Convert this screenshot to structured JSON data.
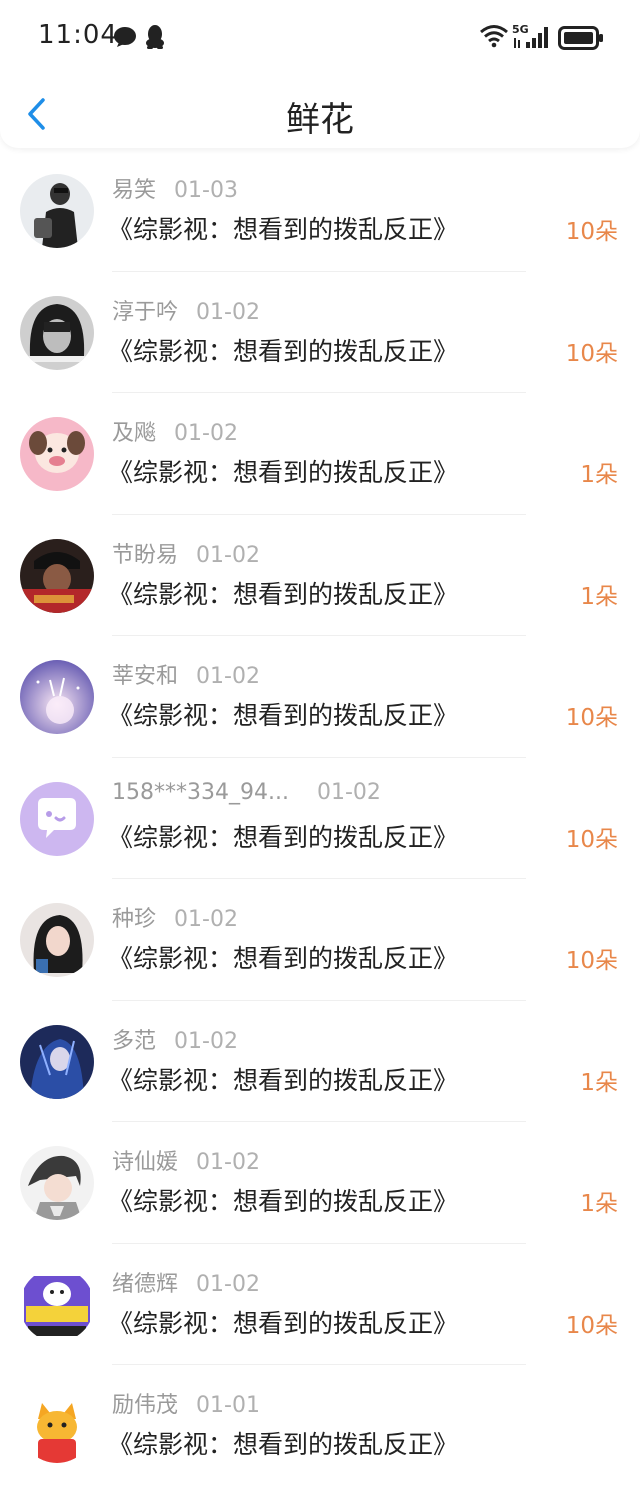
{
  "status_bar": {
    "time": "11:04",
    "network": "5G",
    "icons": [
      "message-icon",
      "penguin-icon",
      "wifi-icon",
      "signal-icon",
      "battery-icon"
    ]
  },
  "header": {
    "title": "鲜花",
    "back_icon": "chevron-left-icon"
  },
  "colors": {
    "accent_blue": "#1e8ee8",
    "amount_orange": "#e8874a",
    "meta_gray": "#9a9a9a"
  },
  "items": [
    {
      "user": "易笑",
      "date": "01-03",
      "book": "《综影视：想看到的拨乱反正》",
      "amount": "10朵",
      "avatar": "photo-avatar"
    },
    {
      "user": "淳于吟",
      "date": "01-02",
      "book": "《综影视：想看到的拨乱反正》",
      "amount": "10朵",
      "avatar": "photo-avatar"
    },
    {
      "user": "及飚",
      "date": "01-02",
      "book": "《综影视：想看到的拨乱反正》",
      "amount": "1朵",
      "avatar": "photo-avatar"
    },
    {
      "user": "节盼易",
      "date": "01-02",
      "book": "《综影视：想看到的拨乱反正》",
      "amount": "1朵",
      "avatar": "photo-avatar"
    },
    {
      "user": "莘安和",
      "date": "01-02",
      "book": "《综影视：想看到的拨乱反正》",
      "amount": "10朵",
      "avatar": "photo-avatar"
    },
    {
      "user": "158***334_94...",
      "date": "01-02",
      "book": "《综影视：想看到的拨乱反正》",
      "amount": "10朵",
      "avatar": "chat-bubble-avatar"
    },
    {
      "user": "种珍",
      "date": "01-02",
      "book": "《综影视：想看到的拨乱反正》",
      "amount": "10朵",
      "avatar": "photo-avatar"
    },
    {
      "user": "多范",
      "date": "01-02",
      "book": "《综影视：想看到的拨乱反正》",
      "amount": "1朵",
      "avatar": "photo-avatar"
    },
    {
      "user": "诗仙媛",
      "date": "01-02",
      "book": "《综影视：想看到的拨乱反正》",
      "amount": "1朵",
      "avatar": "photo-avatar"
    },
    {
      "user": "绪德辉",
      "date": "01-02",
      "book": "《综影视：想看到的拨乱反正》",
      "amount": "10朵",
      "avatar": "photo-avatar"
    },
    {
      "user": "励伟茂",
      "date": "01-01",
      "book": "《综影视：想看到的拨乱反正》",
      "amount": "",
      "avatar": "cartoon-avatar"
    }
  ]
}
